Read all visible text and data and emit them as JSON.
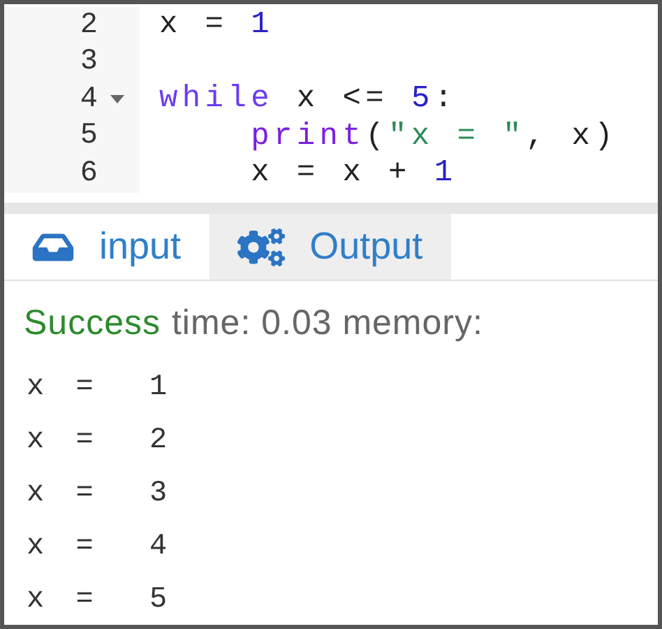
{
  "editor": {
    "lines": [
      {
        "number": "2",
        "tokens": [
          {
            "kind": "plain",
            "text": "x = "
          },
          {
            "kind": "number",
            "text": "1"
          }
        ]
      },
      {
        "number": "3"
      },
      {
        "number": "4",
        "expanded": true,
        "tokens": [
          {
            "kind": "keyword",
            "text": "while"
          },
          {
            "kind": "plain",
            "text": " x <= "
          },
          {
            "kind": "number",
            "text": "5"
          },
          {
            "kind": "plain",
            "text": ":"
          }
        ],
        "children": [
          {
            "number": "5",
            "tokens": [
              {
                "kind": "builtin",
                "text": "print"
              },
              {
                "kind": "plain",
                "text": "("
              },
              {
                "kind": "string",
                "text": "\"x = \""
              },
              {
                "kind": "plain",
                "text": ", x)"
              }
            ]
          },
          {
            "number": "6",
            "tokens": [
              {
                "kind": "plain",
                "text": "x = x + "
              },
              {
                "kind": "number",
                "text": "1"
              }
            ]
          }
        ]
      }
    ]
  },
  "tabs": [
    {
      "label": "input",
      "kind": "input",
      "selected": false
    },
    {
      "label": "Output",
      "kind": "output",
      "selected": true
    }
  ],
  "status": {
    "result": "Success",
    "details": "time: 0.03 memory:"
  },
  "output": [
    "x =  1",
    "x =  2",
    "x =  3",
    "x =  4",
    "x =  5"
  ]
}
